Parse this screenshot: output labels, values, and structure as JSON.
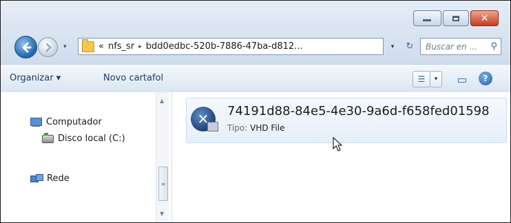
{
  "window": {
    "controls": {
      "minimize_icon": "minimize-icon",
      "maximize_icon": "maximize-icon",
      "close_icon": "close-icon",
      "close_glyph": "✕"
    }
  },
  "nav": {
    "back_glyph": "◀",
    "forward_glyph": "▶",
    "history_glyph": "▾"
  },
  "address": {
    "overflow": "«",
    "segments": [
      "nfs_sr",
      "bdd0edbc-520b-7886-47ba-d812..."
    ],
    "separator": "▸",
    "dropdown_glyph": "▾",
    "refresh_glyph": "↻"
  },
  "search": {
    "placeholder": "Buscar en ...",
    "icon_glyph": "⚲"
  },
  "toolbar": {
    "organize_label": "Organizar ▾",
    "new_folder_label": "Novo cartafol",
    "view_glyph": "☰",
    "view_menu_glyph": "▾",
    "preview_glyph": "▭",
    "help_glyph": "?"
  },
  "sidebar": {
    "items": [
      {
        "label": "Computador",
        "icon": "computer-icon"
      },
      {
        "label": "Disco local (C:)",
        "icon": "disk-icon"
      },
      {
        "label": "Rede",
        "icon": "network-icon"
      }
    ],
    "scroll_up_glyph": "▲",
    "scroll_down_glyph": "▼",
    "scroll_thumb_glyph": "≡"
  },
  "file": {
    "name": "74191d88-84e5-4e30-9a6d-f658fed01598",
    "type_label": "Tipo:",
    "type_value": "VHD File",
    "icon_glyph": "✕"
  },
  "colors": {
    "accent": "#1f63ad",
    "close_button": "#c63e22",
    "tile_border": "#c9dbf1"
  }
}
